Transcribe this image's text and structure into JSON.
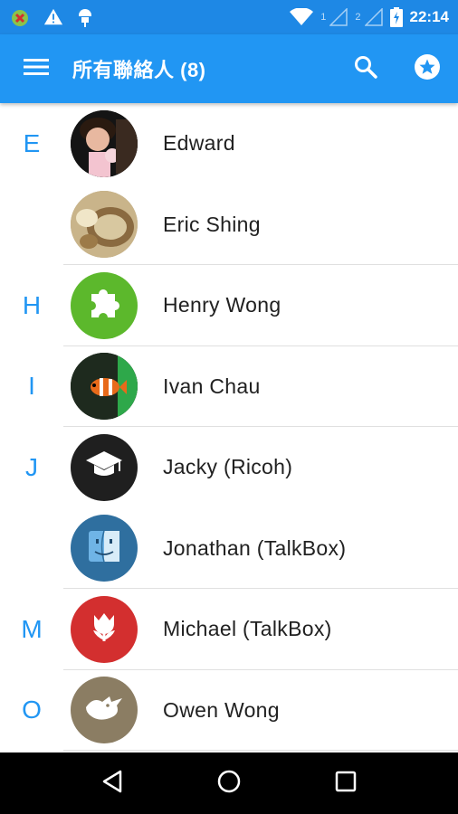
{
  "status_bar": {
    "time": "22:14",
    "sim1": "1",
    "sim2": "2",
    "icons": [
      "android-update-icon",
      "warning-icon",
      "android-debug-icon",
      "wifi-icon",
      "signal-icon",
      "signal-icon",
      "battery-charging-icon"
    ]
  },
  "app_bar": {
    "title": "所有聯絡人 (8)",
    "color": "#2196f3",
    "icons": [
      "menu-icon",
      "search-icon",
      "star-circle-icon"
    ]
  },
  "contacts": [
    {
      "section": "E",
      "name": "Edward",
      "avatar": "photo-avatar",
      "avatar_color": "#1a1a1a"
    },
    {
      "section": "",
      "name": "Eric Shing",
      "avatar": "photo-avatar",
      "avatar_color": "#b5a27a"
    },
    {
      "section": "H",
      "name": "Henry Wong",
      "avatar": "puzzle-icon",
      "avatar_color": "#5cb82c"
    },
    {
      "section": "I",
      "name": "Ivan Chau",
      "avatar": "photo-avatar",
      "avatar_color": "#2a3a2a"
    },
    {
      "section": "J",
      "name": "Jacky (Ricoh)",
      "avatar": "graduation-cap-icon",
      "avatar_color": "#1f1f1f"
    },
    {
      "section": "",
      "name": "Jonathan (TalkBox)",
      "avatar": "finder-icon",
      "avatar_color": "#2f6f9f"
    },
    {
      "section": "M",
      "name": "Michael (TalkBox)",
      "avatar": "tulip-icon",
      "avatar_color": "#d32f2f"
    },
    {
      "section": "O",
      "name": "Owen Wong",
      "avatar": "bird-icon",
      "avatar_color": "#8b7d63"
    }
  ],
  "nav_bar": {
    "icons": [
      "back-icon",
      "home-icon",
      "recents-icon"
    ]
  }
}
